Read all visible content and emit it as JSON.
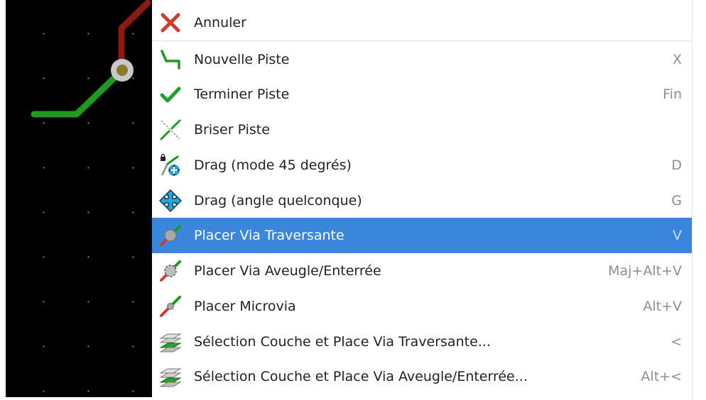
{
  "context_menu": {
    "items": [
      {
        "label": "Annuler",
        "shortcut": "",
        "icon": "cancel-x-icon"
      },
      {
        "label": "Nouvelle Piste",
        "shortcut": "X",
        "icon": "new-track-icon"
      },
      {
        "label": "Terminer Piste",
        "shortcut": "Fin",
        "icon": "checkmark-icon"
      },
      {
        "label": "Briser Piste",
        "shortcut": "",
        "icon": "break-track-icon"
      },
      {
        "label": "Drag (mode 45 degrés)",
        "shortcut": "D",
        "icon": "drag-45-icon"
      },
      {
        "label": "Drag (angle quelconque)",
        "shortcut": "G",
        "icon": "drag-any-angle-icon"
      },
      {
        "label": "Placer Via Traversante",
        "shortcut": "V",
        "icon": "through-via-icon",
        "highlighted": true
      },
      {
        "label": "Placer Via Aveugle/Enterrée",
        "shortcut": "Maj+Alt+V",
        "icon": "blind-buried-via-icon"
      },
      {
        "label": "Placer Microvia",
        "shortcut": "Alt+V",
        "icon": "microvia-icon"
      },
      {
        "label": "Sélection Couche  et Place Via Traversante...",
        "shortcut": "<",
        "icon": "select-layer-through-via-icon"
      },
      {
        "label": "Sélection Couche  et Place Via Aveugle/Enterrée...",
        "shortcut": "Alt+<",
        "icon": "select-layer-blind-via-icon"
      }
    ]
  },
  "colors": {
    "highlight": "#3a86dd",
    "canvas_background": "#000000",
    "track_front": "#1f9a1f",
    "track_back": "#8b1a12",
    "via_ring": "#c8c8c8",
    "via_hole": "#8b7a2e"
  }
}
